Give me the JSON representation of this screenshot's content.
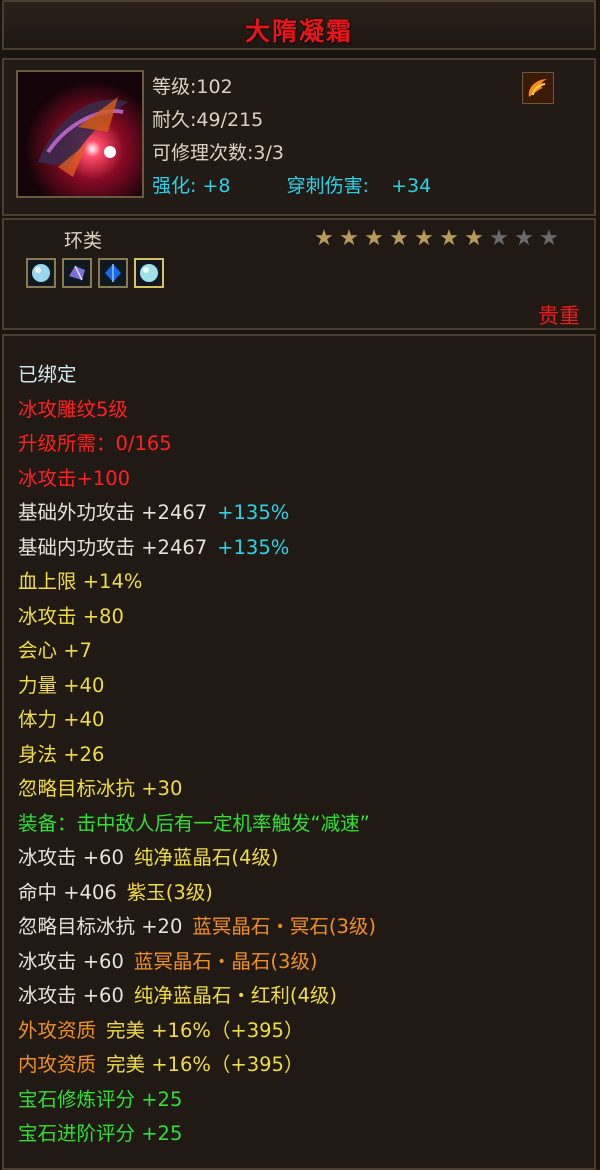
{
  "item": {
    "name": "大隋凝霜",
    "level": "等级:102",
    "durability": "耐久:49/215",
    "repair": "可修理次数:3/3",
    "enhance_label": "强化:",
    "enhance_value": "+8",
    "pierce_label": "穿刺伤害:",
    "pierce_value": "+34",
    "type": "环类",
    "rarity": "贵重",
    "stars": {
      "filled": 7,
      "total": 10
    }
  },
  "colors": {
    "title": "#e8141a",
    "cyan": "#27d3ea",
    "yellow": "#f0dc40",
    "green": "#30e030",
    "orange": "#f09020",
    "red": "#ff2020"
  },
  "gems": [
    "ice-crystal-gem-icon",
    "purple-crystal-gem-icon",
    "blue-crystal-gem-icon",
    "ice-crystal-gem-icon"
  ],
  "attributes": [
    {
      "parts": [
        {
          "t": "已绑定",
          "c": "ice"
        }
      ]
    },
    {
      "parts": [
        {
          "t": "冰攻雕纹5级",
          "c": "red"
        }
      ]
    },
    {
      "parts": [
        {
          "t": "升级所需：0/165",
          "c": "red"
        }
      ]
    },
    {
      "parts": [
        {
          "t": "冰攻击+100",
          "c": "red"
        }
      ]
    },
    {
      "parts": [
        {
          "t": "基础外功攻击 +2467",
          "c": "white"
        },
        {
          "t": "+135%",
          "c": "cyan"
        }
      ]
    },
    {
      "parts": [
        {
          "t": "基础内功攻击 +2467",
          "c": "white"
        },
        {
          "t": "+135%",
          "c": "cyan"
        }
      ]
    },
    {
      "parts": [
        {
          "t": "血上限 +14%",
          "c": "yellow"
        }
      ]
    },
    {
      "parts": [
        {
          "t": "冰攻击 +80",
          "c": "yellow"
        }
      ]
    },
    {
      "parts": [
        {
          "t": "会心 +7",
          "c": "yellow"
        }
      ]
    },
    {
      "parts": [
        {
          "t": "力量 +40",
          "c": "yellow"
        }
      ]
    },
    {
      "parts": [
        {
          "t": "体力 +40",
          "c": "yellow"
        }
      ]
    },
    {
      "parts": [
        {
          "t": "身法 +26",
          "c": "yellow"
        }
      ]
    },
    {
      "parts": [
        {
          "t": "忽略目标冰抗 +30",
          "c": "yellow"
        }
      ]
    },
    {
      "parts": [
        {
          "t": "装备：击中敌人后有一定机率触发“减速”",
          "c": "green"
        }
      ]
    },
    {
      "parts": [
        {
          "t": "冰攻击 +60",
          "c": "white"
        },
        {
          "t": "纯净蓝晶石(4级)",
          "c": "yellow"
        }
      ]
    },
    {
      "parts": [
        {
          "t": "命中 +406",
          "c": "white"
        },
        {
          "t": "紫玉(3级)",
          "c": "yellow"
        }
      ]
    },
    {
      "parts": [
        {
          "t": "忽略目标冰抗 +20",
          "c": "white"
        },
        {
          "t": "蓝冥晶石・冥石(3级)",
          "c": "orange"
        }
      ]
    },
    {
      "parts": [
        {
          "t": "冰攻击 +60",
          "c": "white"
        },
        {
          "t": "蓝冥晶石・晶石(3级)",
          "c": "orange"
        }
      ]
    },
    {
      "parts": [
        {
          "t": "冰攻击 +60",
          "c": "white"
        },
        {
          "t": "纯净蓝晶石・红利(4级)",
          "c": "yellow"
        }
      ]
    },
    {
      "parts": [
        {
          "t": "外攻资质",
          "c": "orange"
        },
        {
          "t": "完美 +16%（+395）",
          "c": "yellow"
        }
      ]
    },
    {
      "parts": [
        {
          "t": "内攻资质",
          "c": "orange"
        },
        {
          "t": "完美 +16%（+395）",
          "c": "yellow"
        }
      ]
    },
    {
      "parts": [
        {
          "t": "宝石修炼评分 +25",
          "c": "green"
        }
      ]
    },
    {
      "parts": [
        {
          "t": "宝石进阶评分 +25",
          "c": "green"
        }
      ]
    }
  ]
}
